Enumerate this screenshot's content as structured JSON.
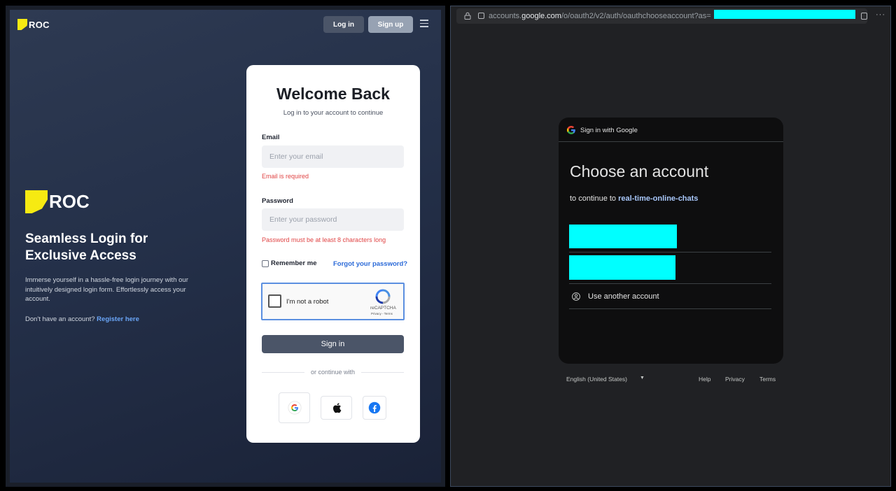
{
  "left": {
    "header": {
      "logo_text": "ROC",
      "login_label": "Log in",
      "signup_label": "Sign up"
    },
    "hero": {
      "logo_text": "ROC",
      "title": "Seamless Login for Exclusive Access",
      "description": "Immerse yourself in a hassle-free login journey with our intuitively designed login form. Effortlessly access your account.",
      "register_prompt": "Don't have an account?",
      "register_link": "Register here"
    },
    "card": {
      "title": "Welcome Back",
      "subtitle": "Log in to your account to continue",
      "email_label": "Email",
      "email_placeholder": "Enter your email",
      "email_error": "Email is required",
      "password_label": "Password",
      "password_placeholder": "Enter your password",
      "password_error": "Password must be at least 8 characters long",
      "remember_label": "Remember me",
      "forgot_label": "Forgot your password?",
      "captcha_label": "I'm not a robot",
      "captcha_brand": "reCAPTCHA",
      "captcha_links": "Privacy - Terms",
      "signin_label": "Sign in",
      "divider_text": "or continue with",
      "social": [
        "google-icon",
        "apple-icon",
        "facebook-icon"
      ]
    }
  },
  "right": {
    "urlbar": {
      "prefix": "accounts.",
      "domain": "google.com",
      "path": "/o/oauth2/v2/auth/oauthchooseaccount?as="
    },
    "google": {
      "header": "Sign in with Google",
      "title": "Choose an account",
      "continue_prefix": "to continue to",
      "app_name": "real-time-online-chats",
      "another_account": "Use another account"
    },
    "footer": {
      "language": "English (United States)",
      "help": "Help",
      "privacy": "Privacy",
      "terms": "Terms"
    }
  },
  "colors": {
    "redaction": "#00ffff",
    "brand_yellow": "#f6ea12",
    "link_blue": "#2b6ad8",
    "error_red": "#e04444"
  }
}
